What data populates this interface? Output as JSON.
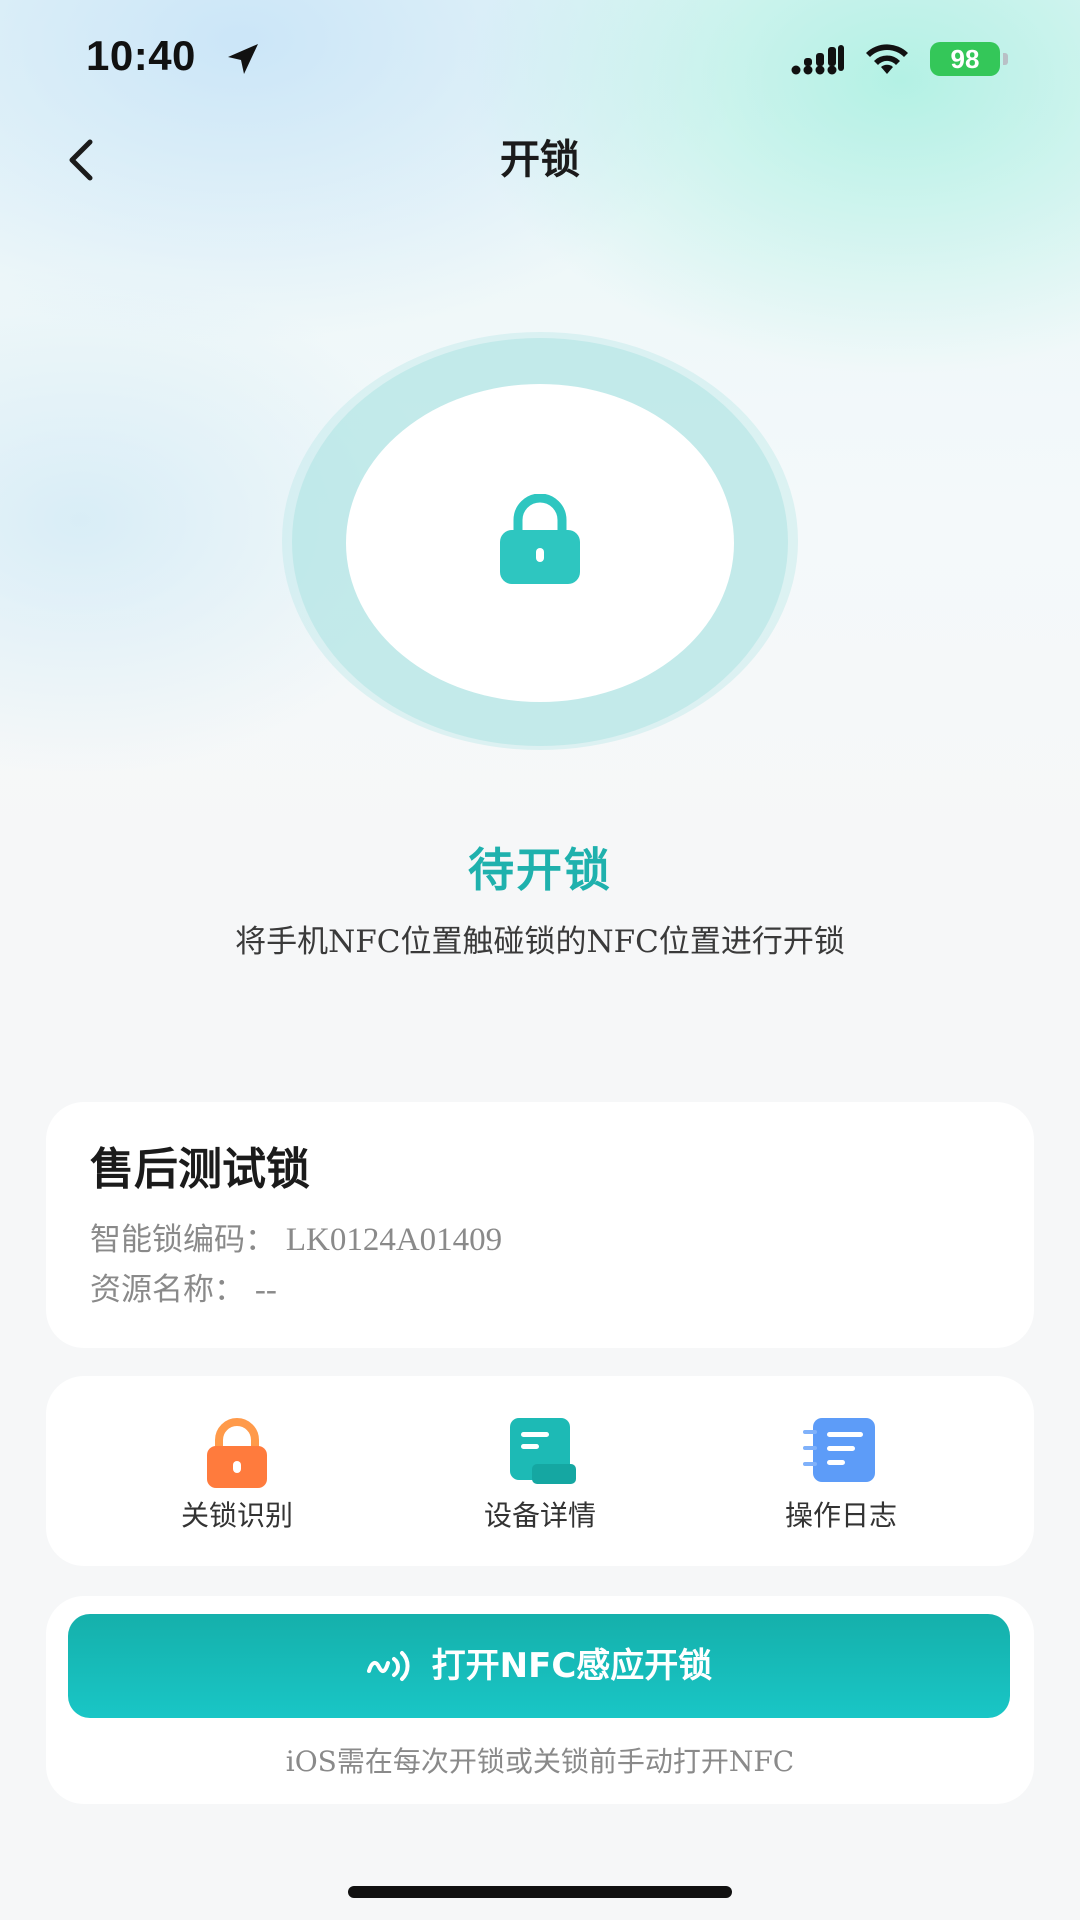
{
  "status_bar": {
    "time": "10:40",
    "battery_level": "98",
    "battery_color": "#34c759",
    "icons": [
      "location-arrow-icon",
      "cellular-signal-icon",
      "wifi-icon",
      "battery-charging-icon"
    ]
  },
  "nav": {
    "title": "开锁",
    "back_icon": "chevron-left-icon"
  },
  "lock": {
    "status": "待开锁",
    "hint": "将手机NFC位置触碰锁的NFC位置进行开锁",
    "icon": "padlock-icon",
    "accent_color": "#1fb1ad"
  },
  "info": {
    "name": "售后测试锁",
    "code_label": "智能锁编码：",
    "code_value": "LK0124A01409",
    "resource_label": "资源名称：",
    "resource_value": "--"
  },
  "actions": [
    {
      "label": "关锁识别",
      "icon": "orange-padlock-icon",
      "color": "#ff7b3d"
    },
    {
      "label": "设备详情",
      "icon": "device-details-icon",
      "color": "#1dbab5"
    },
    {
      "label": "操作日志",
      "icon": "operation-log-icon",
      "color": "#5d9cf8"
    }
  ],
  "nfc": {
    "button_label": "打开NFC感应开锁",
    "icon": "nfc-signal-icon",
    "note": "iOS需在每次开锁或关锁前手动打开NFC"
  }
}
